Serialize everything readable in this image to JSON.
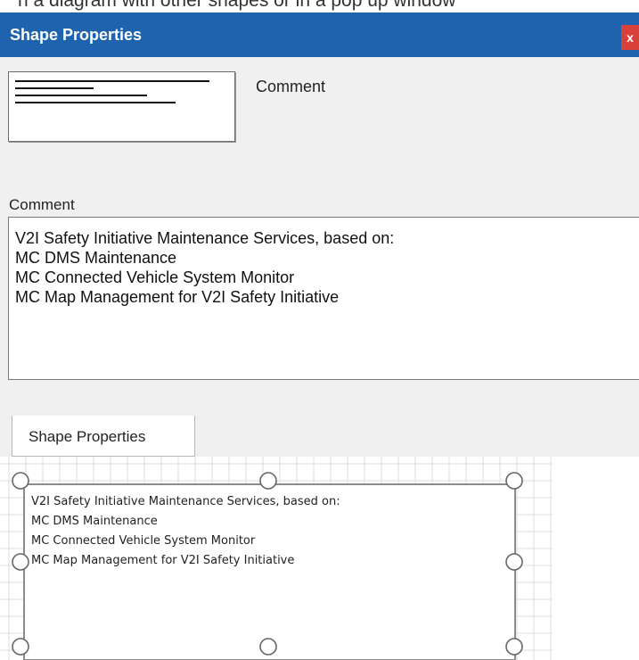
{
  "top_partial_text": "n a diagram with other shapes or in a pop up window",
  "dialog": {
    "title": "Shape Properties",
    "close_label": "x",
    "thumbnail_label": "Comment",
    "field_label": "Comment",
    "comment_lines": [
      "V2I Safety Initiative Maintenance Services, based on:",
      "MC DMS Maintenance",
      "MC Connected Vehicle System Monitor",
      "MC Map Management for V2I Safety Initiative"
    ],
    "tab_label": "Shape Properties"
  },
  "shape": {
    "text_lines": [
      "V2I Safety Initiative Maintenance Services, based on:",
      "MC DMS Maintenance",
      "MC Connected Vehicle System Monitor",
      "MC Map Management for V2I Safety Initiative"
    ]
  },
  "colors": {
    "titlebar": "#1f63ae",
    "close_button": "#d9403a",
    "panel_bg": "#f0f0f0"
  }
}
